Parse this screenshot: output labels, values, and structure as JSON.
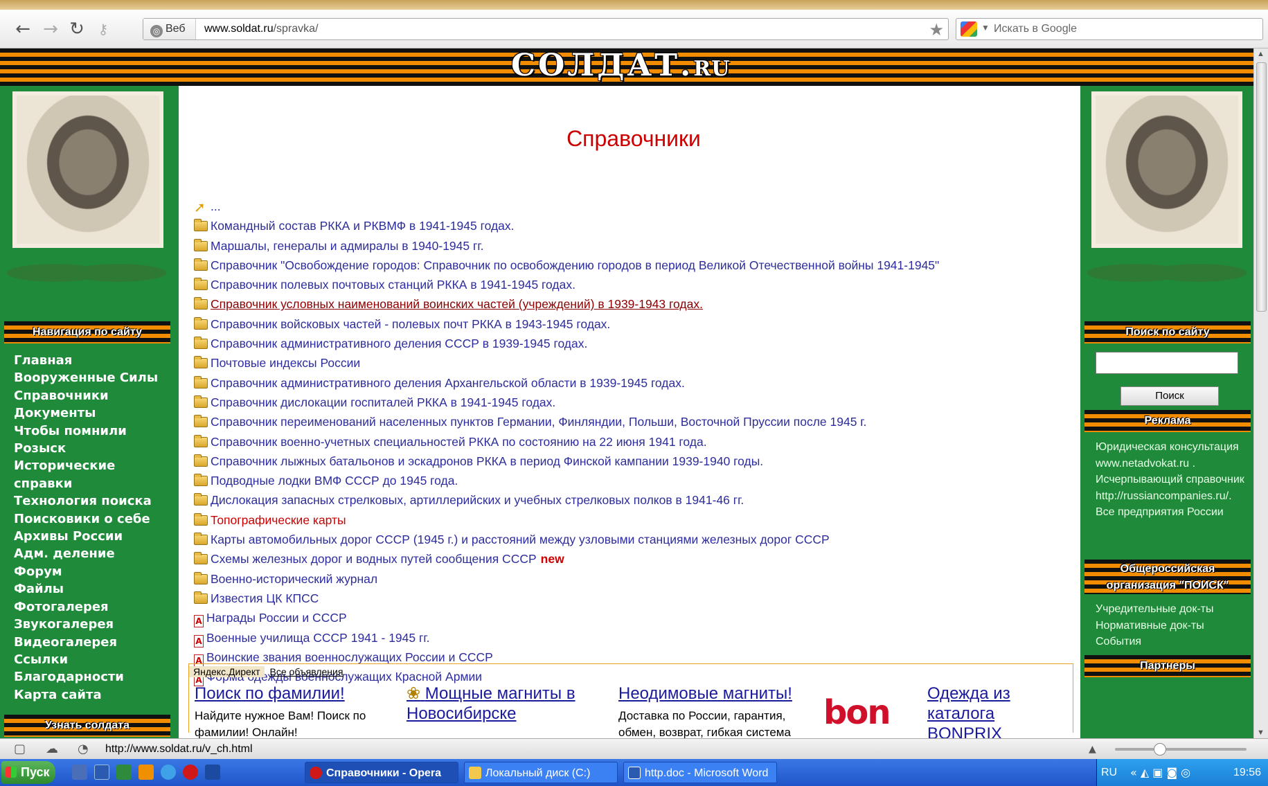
{
  "browser": {
    "address_badge": "Веб",
    "url_domain": "www.soldat.ru",
    "url_path": "/spravka/",
    "search_placeholder": "Искать в Google"
  },
  "site": {
    "logo_main": "СОЛДАТ.",
    "logo_suffix": "RU",
    "heading": "Справочники"
  },
  "left_sidebar": {
    "nav_title": "Навигация по сайту",
    "nav_items": [
      "Главная",
      "Вооруженные Силы",
      "Справочники",
      "Документы",
      "Чтобы помнили",
      "Розыск",
      "Исторические",
      "справки",
      "Технология поиска",
      "Поисковики о себе",
      "Архивы России",
      "Адм. деление",
      "Форум",
      "Файлы",
      "Фотогалерея",
      "Звукогалерея",
      "Видеогалерея",
      "Ссылки",
      "Благодарности",
      "Карта сайта"
    ],
    "bottom_title": "Узнать солдата"
  },
  "right_sidebar": {
    "search_title": "Поиск по сайту",
    "search_button": "Поиск",
    "ads_title": "Реклама",
    "ads_text": "Юридическая консультация www.netadvokat.ru . Исчерпывающий справочник http://russiancompanies.ru/. Все предприятия России",
    "org_title": "Общероссийская организация \"ПОИСК\"",
    "org_links": [
      "Учредительные док-ты",
      "Нормативные док-ты",
      "События"
    ],
    "partners_title": "Партнеры"
  },
  "directory": {
    "up_label": "...",
    "items": [
      {
        "label": "Командный состав РККА и РКВМФ в 1941-1945 годах.",
        "icon": "folder-icon"
      },
      {
        "label": "Маршалы, генералы и адмиралы в 1940-1945 гг.",
        "icon": "folder-icon"
      },
      {
        "label": "Справочник \"Освобождение городов: Справочник по освобождению городов в период Великой Отечественной войны 1941-1945\"",
        "icon": "folder-icon"
      },
      {
        "label": "Справочник полевых почтовых станций РККА в 1941-1945 годах.",
        "icon": "folder-icon"
      },
      {
        "label": "Справочник условных наименований воинских частей (учреждений) в 1939-1943 годах.",
        "icon": "folder-icon",
        "state": "active"
      },
      {
        "label": "Справочник войсковых частей - полевых почт РККА в 1943-1945 годах.",
        "icon": "folder-icon"
      },
      {
        "label": "Справочник административного деления СССР в 1939-1945 годах.",
        "icon": "folder-icon"
      },
      {
        "label": "Почтовые индексы России",
        "icon": "folder-icon"
      },
      {
        "label": "Справочник административного деления Архангельской области в 1939-1945 годах.",
        "icon": "folder-icon"
      },
      {
        "label": "Справочник дислокации госпиталей РККА в 1941-1945 годах.",
        "icon": "folder-icon"
      },
      {
        "label": "Справочник переименований населенных пунктов Германии, Финляндии, Польши, Восточной Пруссии после 1945 г.",
        "icon": "folder-icon"
      },
      {
        "label": "Справочник военно-учетных специальностей РККА по состоянию на 22 июня 1941 года.",
        "icon": "folder-icon"
      },
      {
        "label": "Справочник лыжных батальонов и эскадронов РККА в период Финской кампании 1939-1940 годы.",
        "icon": "folder-icon"
      },
      {
        "label": "Подводные лодки ВМФ СССР до 1945 года.",
        "icon": "folder-icon"
      },
      {
        "label": "Дислокация запасных стрелковых, артиллерийских и учебных стрелковых полков в 1941-46 гг.",
        "icon": "folder-icon"
      },
      {
        "label": "Топографические карты",
        "icon": "folder-icon",
        "state": "red"
      },
      {
        "label": "Карты автомобильных дорог СССР (1945 г.) и расстояний между узловыми станциями железных дорог СССР",
        "icon": "folder-icon"
      },
      {
        "label": "Схемы железных дорог и водных путей сообщения СССР",
        "icon": "folder-icon",
        "badge": "new"
      },
      {
        "label": "Военно-исторический журнал",
        "icon": "folder-icon"
      },
      {
        "label": "Известия ЦК КПСС",
        "icon": "folder-icon"
      },
      {
        "label": "Награды России и СССР",
        "icon": "pdf-icon"
      },
      {
        "label": "Военные училища СССР 1941 - 1945 гг.",
        "icon": "pdf-icon"
      },
      {
        "label": "Воинские звания военнослужащих России и СССР",
        "icon": "pdf-icon"
      },
      {
        "label": "Форма одежды военнослужащих Красной Армии",
        "icon": "pdf-icon"
      }
    ]
  },
  "yandex_direct": {
    "label": "Яндекс.Директ",
    "all_link": "Все объявления",
    "ads": [
      {
        "title": "Поиск по фамилии!",
        "text": "Найдите нужное Вам! Поиск по фамилии! Онлайн!"
      },
      {
        "title": "Мощные магниты в Новосибирске",
        "text": ""
      },
      {
        "title": "Неодимовые магниты!",
        "text": "Доставка по России, гарантия, обмен, возврат, гибкая система"
      },
      {
        "title": "Одежда из каталога BONPRIX",
        "text": ""
      }
    ],
    "bonprix_logo": "bon"
  },
  "statusbar": {
    "url": "http://www.soldat.ru/v_ch.html"
  },
  "taskbar": {
    "start_label": "Пуск",
    "tasks": [
      "Справочники - Opera",
      "Локальный диск (C:)",
      "http.doc - Microsoft Word"
    ],
    "lang": "RU",
    "clock": "19:56"
  }
}
